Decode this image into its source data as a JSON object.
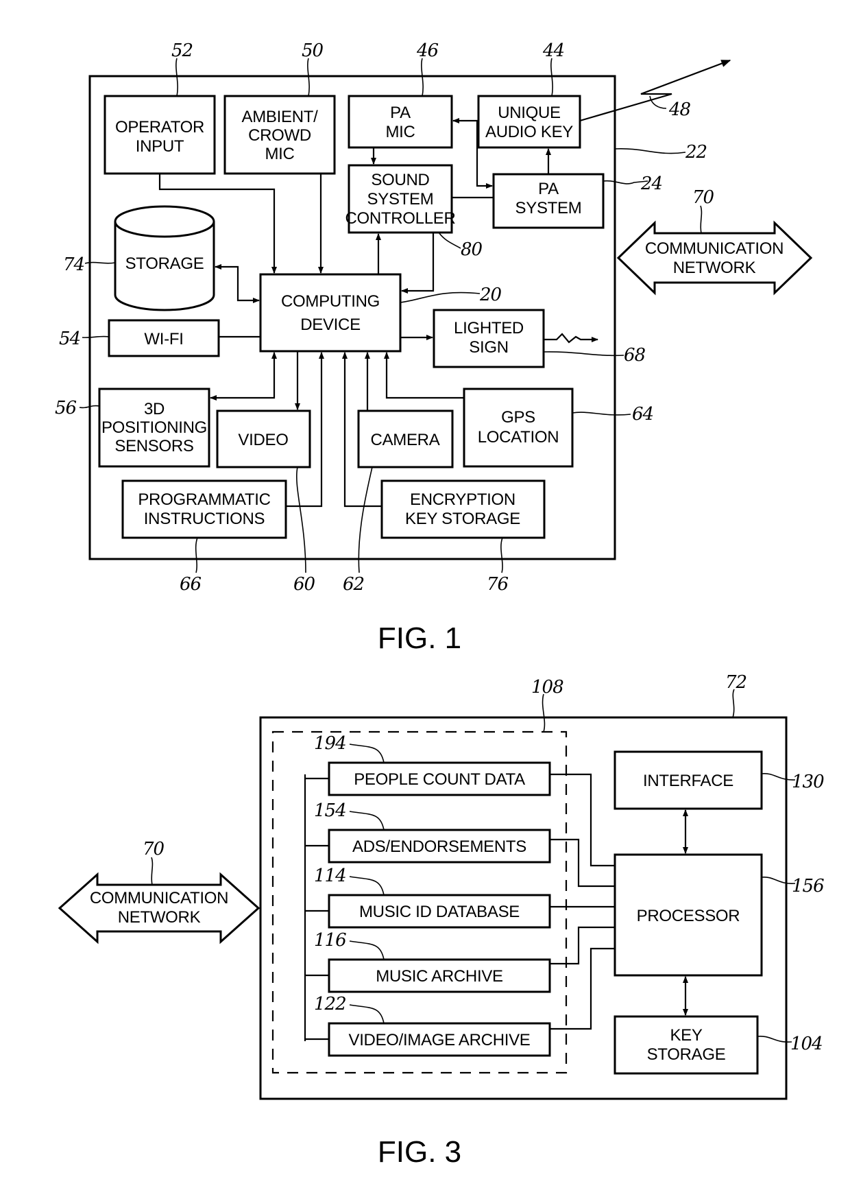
{
  "fig1": {
    "caption": "FIG. 1",
    "system_ref": "22",
    "blocks": {
      "operator_input": {
        "lines": [
          "OPERATOR",
          "INPUT"
        ],
        "ref": "52"
      },
      "ambient_crowd_mic": {
        "lines": [
          "AMBIENT/",
          "CROWD",
          "MIC"
        ],
        "ref": "50"
      },
      "pa_mic": {
        "lines": [
          "PA",
          "MIC"
        ],
        "ref": "46"
      },
      "unique_audio_key": {
        "lines": [
          "UNIQUE",
          "AUDIO KEY"
        ],
        "ref": "44"
      },
      "sound_system_controller": {
        "lines": [
          "SOUND",
          "SYSTEM",
          "CONTROLLER"
        ],
        "ref": "80"
      },
      "pa_system": {
        "lines": [
          "PA",
          "SYSTEM"
        ],
        "ref": "24"
      },
      "storage": {
        "lines": [
          "STORAGE"
        ],
        "ref": "74"
      },
      "computing_device": {
        "lines": [
          "COMPUTING",
          "DEVICE"
        ],
        "ref": "20"
      },
      "wifi": {
        "lines": [
          "WI-FI"
        ],
        "ref": "54"
      },
      "lighted_sign": {
        "lines": [
          "LIGHTED",
          "SIGN"
        ],
        "ref": "68"
      },
      "positioning_sensors": {
        "lines": [
          "3D",
          "POSITIONING",
          "SENSORS"
        ],
        "ref": "56"
      },
      "video": {
        "lines": [
          "VIDEO"
        ],
        "ref": "60"
      },
      "camera": {
        "lines": [
          "CAMERA"
        ],
        "ref": "62"
      },
      "gps_location": {
        "lines": [
          "GPS",
          "LOCATION"
        ],
        "ref": "64"
      },
      "programmatic_instructions": {
        "lines": [
          "PROGRAMMATIC",
          "INSTRUCTIONS"
        ],
        "ref": "66"
      },
      "encryption_key_storage": {
        "lines": [
          "ENCRYPTION",
          "KEY STORAGE"
        ],
        "ref": "76"
      }
    },
    "wireless_ref": "48",
    "network": {
      "lines": [
        "COMMUNICATION",
        "NETWORK"
      ],
      "ref": "70"
    }
  },
  "fig3": {
    "caption": "FIG. 3",
    "system_ref": "72",
    "group_ref": "108",
    "data_stores": [
      {
        "label": "PEOPLE COUNT DATA",
        "ref": "194"
      },
      {
        "label": "ADS/ENDORSEMENTS",
        "ref": "154"
      },
      {
        "label": "MUSIC ID DATABASE",
        "ref": "114"
      },
      {
        "label": "MUSIC ARCHIVE",
        "ref": "116"
      },
      {
        "label": "VIDEO/IMAGE ARCHIVE",
        "ref": "122"
      }
    ],
    "interface": {
      "lines": [
        "INTERFACE"
      ],
      "ref": "130"
    },
    "processor": {
      "lines": [
        "PROCESSOR"
      ],
      "ref": "156"
    },
    "key_storage": {
      "lines": [
        "KEY",
        "STORAGE"
      ],
      "ref": "104"
    },
    "network": {
      "lines": [
        "COMMUNICATION",
        "NETWORK"
      ],
      "ref": "70"
    }
  }
}
